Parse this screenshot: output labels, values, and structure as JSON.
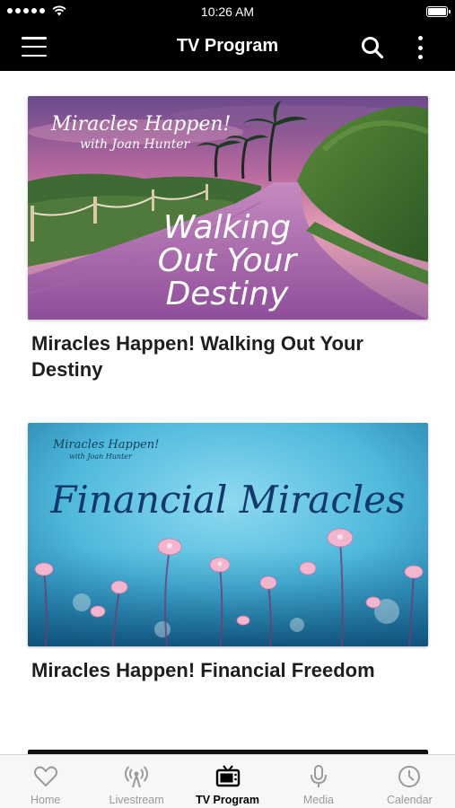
{
  "status_bar": {
    "time": "10:26 AM"
  },
  "nav": {
    "title": "TV Program",
    "icons": [
      "menu-icon",
      "search-icon",
      "more-vertical-icon"
    ]
  },
  "cards": [
    {
      "title": "Miracles Happen! Walking Out Your Destiny",
      "image": {
        "brand_line1": "Miracles Happen!",
        "brand_line2": "with Joan Hunter",
        "headline_line1": "Walking",
        "headline_line2": "Out Your",
        "headline_line3": "Destiny"
      }
    },
    {
      "title": "Miracles Happen! Financial Freedom",
      "image": {
        "brand_line1": "Miracles Happen!",
        "brand_line2": "with Joan Hunter",
        "headline": "Financial Miracles"
      }
    }
  ],
  "tabs": [
    {
      "label": "Home",
      "icon": "heart-icon",
      "active": false
    },
    {
      "label": "Livestream",
      "icon": "broadcast-icon",
      "active": false
    },
    {
      "label": "TV Program",
      "icon": "tv-icon",
      "active": true
    },
    {
      "label": "Media",
      "icon": "microphone-icon",
      "active": false
    },
    {
      "label": "Calendar",
      "icon": "clock-icon",
      "active": false
    }
  ],
  "colors": {
    "bar_background": "#000000",
    "tab_active": "#000000",
    "tab_inactive": "#9a9a9a"
  }
}
